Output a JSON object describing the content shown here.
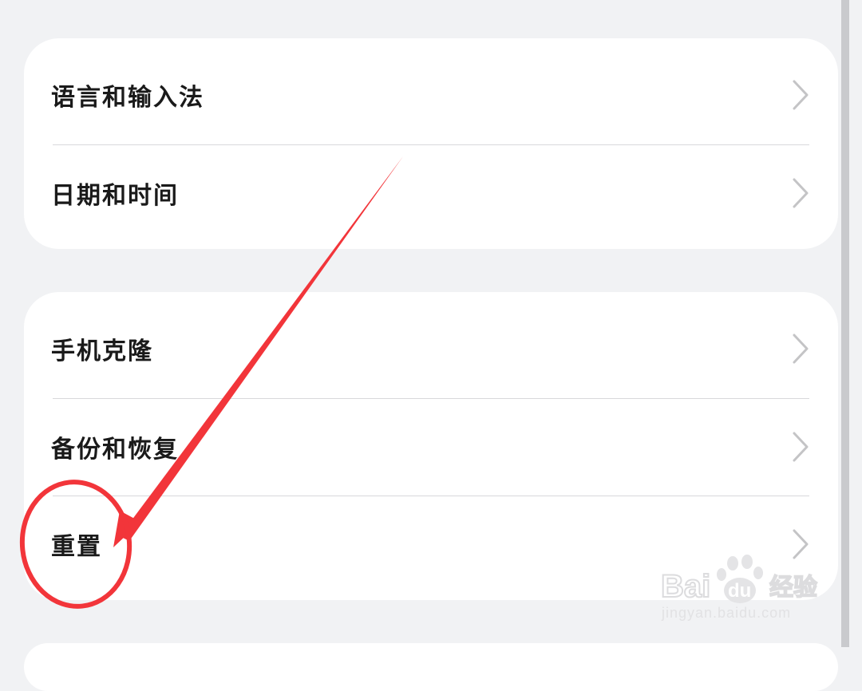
{
  "groups": [
    {
      "items": [
        {
          "label": "语言和输入法",
          "icon": "chevron-right-icon"
        },
        {
          "label": "日期和时间",
          "icon": "chevron-right-icon"
        }
      ]
    },
    {
      "items": [
        {
          "label": "手机克隆",
          "icon": "chevron-right-icon"
        },
        {
          "label": "备份和恢复",
          "icon": "chevron-right-icon"
        },
        {
          "label": "重置",
          "icon": "chevron-right-icon"
        }
      ]
    }
  ],
  "annotation": {
    "color": "#f2353a",
    "target": "重置"
  },
  "watermark": {
    "logo": "Bai du 经验",
    "url": "jingyan.baidu.com"
  }
}
